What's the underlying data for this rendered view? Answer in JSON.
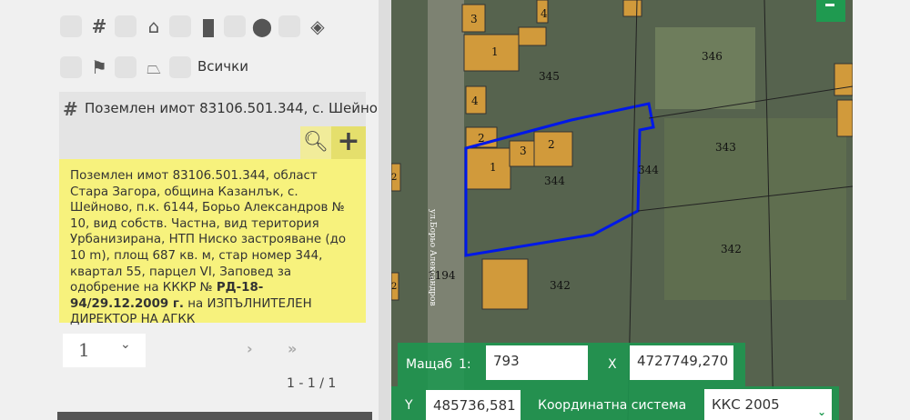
{
  "filters": {
    "all_label": "Всички",
    "icons": [
      "grid-icon",
      "home-icon",
      "door-icon",
      "location-pin-icon",
      "layers-icon",
      "flag-icon",
      "polygon-icon"
    ]
  },
  "result": {
    "title": "Поземлен имот 83106.501.344, с. Шейново",
    "description_pre": "Поземлен имот 83106.501.344, област Стара Загора, община Казанлък, с. Шейново, п.к. 6144, Борьо Александров № 10, вид собств. Частна, вид територия Урбанизирана, НТП Ниско застрояване (до 10 m), площ 687 кв. м, стар номер 344, квартал 55, парцел VI, Заповед за одобрение на КККР № ",
    "description_bold": "РД-18-94/29.12.2009 г.",
    "description_post": " на ИЗПЪЛНИТЕЛЕН ДИРЕКТОР НА АГКК"
  },
  "pagination": {
    "page": "1",
    "count": "1 - 1 / 1"
  },
  "map": {
    "labels": [
      "3",
      "4",
      "1",
      "345",
      "346",
      "4",
      "2",
      "3",
      "2",
      "1",
      "344",
      "344",
      "343",
      "342",
      "1194",
      "342",
      "2",
      "2"
    ],
    "street": "ул.Борьо Александров"
  },
  "coords": {
    "scale_label": "Мащаб",
    "scale_prefix": "1:",
    "scale": "793",
    "x_label": "X",
    "x": "4727749,270",
    "y_label": "Y",
    "y": "485736,581",
    "crs_label": "Координатна система",
    "crs": "ККС 2005"
  },
  "colors": {
    "accent": "#1f9a50",
    "highlight": "#f7f27d",
    "parcel": "#0018e8"
  }
}
